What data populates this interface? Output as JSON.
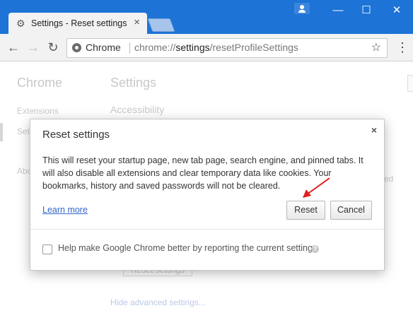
{
  "tab": {
    "title": "Settings - Reset settings",
    "favicon": "gear-icon",
    "close": "×"
  },
  "window": {
    "profile_icon": "person-icon",
    "minimize": "—",
    "maximize": "☐",
    "close": "✕"
  },
  "toolbar": {
    "back": "←",
    "forward": "→",
    "reload": "↻",
    "chip_label": "Chrome",
    "url_prefix": "chrome://",
    "url_host": "settings",
    "url_path": "/resetProfileSettings",
    "star": "☆",
    "menu": "⋮"
  },
  "background": {
    "sidebar_title": "Chrome",
    "sidebar_extensions": "Extensions",
    "sidebar_settings": "Settings",
    "sidebar_about": "About",
    "main_title": "Settings",
    "accessibility": "Accessibility",
    "right_fragment": "ed",
    "reset_button": "Reset settings",
    "hide_advanced": "Hide advanced settings..."
  },
  "dialog": {
    "title": "Reset settings",
    "close": "×",
    "body": "This will reset your startup page, new tab page, search engine, and pinned tabs. It will also disable all extensions and clear temporary data like cookies. Your bookmarks, history and saved passwords will not be cleared.",
    "learn_more": "Learn more",
    "reset": "Reset",
    "cancel": "Cancel",
    "report_label": "Help make Google Chrome better by reporting the current settings",
    "report_checked": false,
    "help_icon": "?"
  },
  "colors": {
    "titlebar": "#1d73d6",
    "link": "#3265c9",
    "arrow": "#e02020"
  }
}
